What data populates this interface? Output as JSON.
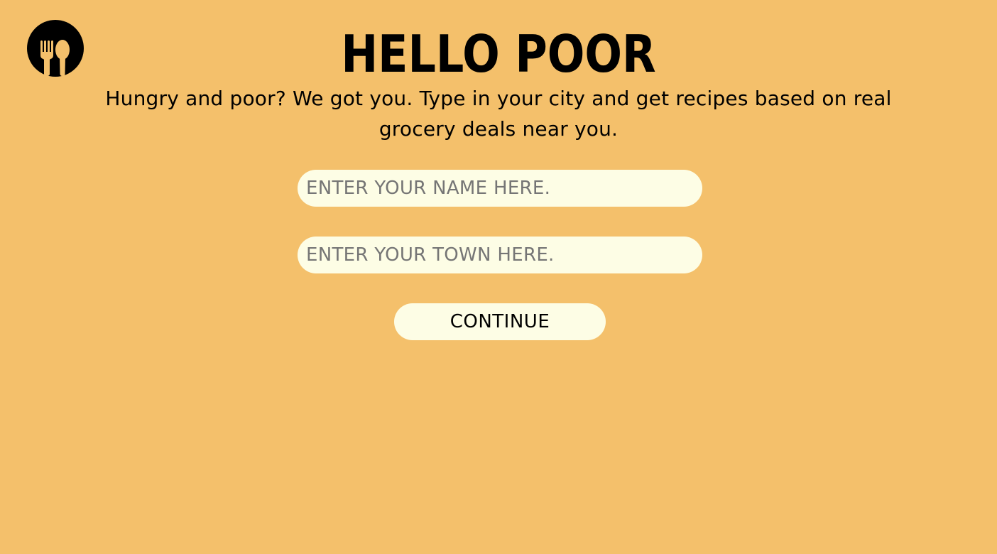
{
  "colors": {
    "background": "#F4C06B",
    "text": "#000000",
    "field_background": "#FDFDE5",
    "logo_circle": "#000000",
    "logo_glyph": "#F4C06B"
  },
  "header": {
    "logo_icon": "fork-spoon-icon",
    "title": "HELLO POOR",
    "subtitle": "Hungry and poor? We got you. Type in your city and get recipes based on real grocery deals near you."
  },
  "form": {
    "name_placeholder": "ENTER YOUR NAME HERE.",
    "name_value": "",
    "town_placeholder": "ENTER YOUR TOWN HERE.",
    "town_value": "",
    "continue_label": "CONTINUE"
  }
}
